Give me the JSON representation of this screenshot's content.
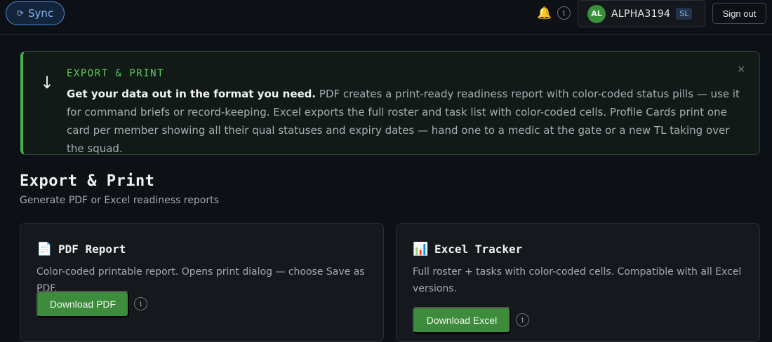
{
  "topbar": {
    "sync_label": "Sync",
    "sync_glyph": "⟳",
    "notification_icon": "bell-icon",
    "info_glyph": "i",
    "user": {
      "initials": "AL",
      "callsign": "ALPHA3194",
      "role": "SL"
    },
    "signout_label": "Sign out"
  },
  "banner": {
    "eyebrow": "EXPORT & PRINT",
    "lead": "Get your data out in the format you need.",
    "body": " PDF creates a print-ready readiness report with color-coded status pills — use it for command briefs or record-keeping. Excel exports the full roster and task list with color-coded cells. Profile Cards print one card per member showing all their qual statuses and expiry dates — hand one to a medic at the gate or a new TL taking over the squad.",
    "arrow_glyph": "↓",
    "close_glyph": "×"
  },
  "page": {
    "title": "Export & Print",
    "subtitle": "Generate PDF or Excel readiness reports"
  },
  "cards": {
    "pdf": {
      "icon_glyph": "📄",
      "title": "PDF Report",
      "description": "Color-coded printable report. Opens print dialog — choose Save as PDF.",
      "button_label": "Download PDF"
    },
    "excel": {
      "icon_glyph": "📊",
      "title": "Excel Tracker",
      "description": "Full roster + tasks with color-coded cells. Compatible with all Excel versions.",
      "button_label": "Download Excel"
    }
  },
  "colors": {
    "accent_green": "#45b04a",
    "sync_blue": "#4a8ad8",
    "background": "#0d1014"
  }
}
